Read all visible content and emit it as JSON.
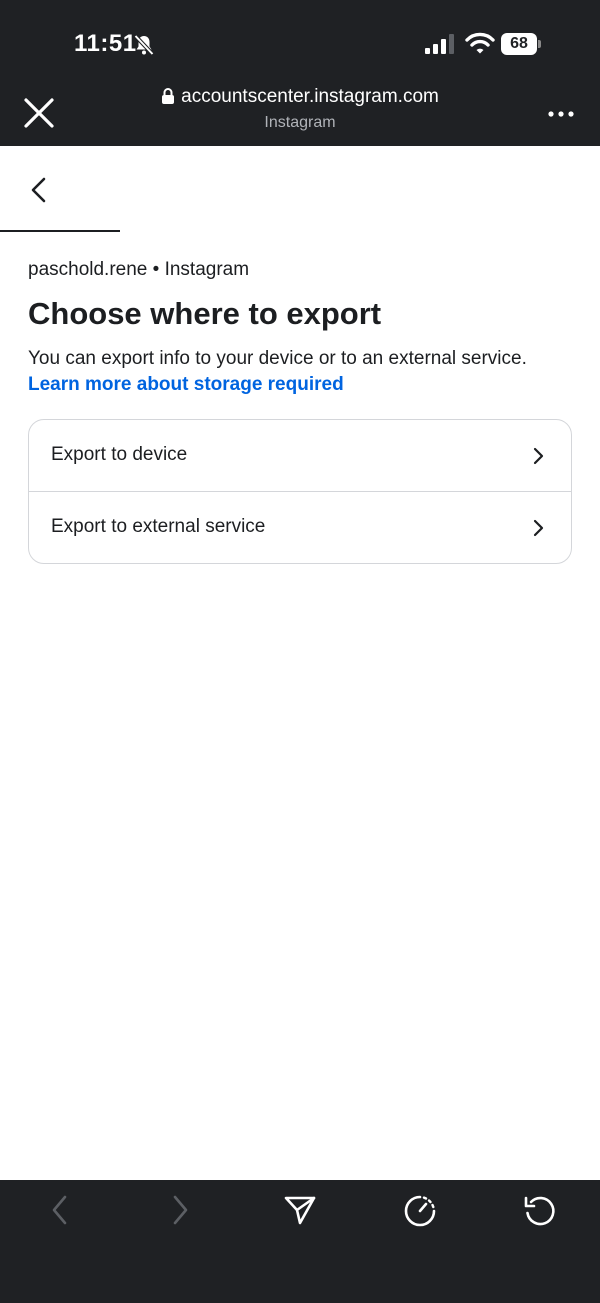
{
  "status_bar": {
    "time": "11:51",
    "battery": "68"
  },
  "browser": {
    "url": "accountscenter.instagram.com",
    "subtitle": "Instagram"
  },
  "content": {
    "account_line": "paschold.rene • Instagram",
    "title": "Choose where to export",
    "description": "You can export info to your device or to an external service.",
    "learn_more": "Learn more about storage required",
    "options": [
      {
        "label": "Export to device"
      },
      {
        "label": "Export to external service"
      }
    ]
  },
  "icons": {
    "top_left": "close-icon",
    "top_right": "more-icon",
    "back": "chevron-left-icon",
    "toolbar": [
      "back-arrow-icon",
      "forward-arrow-icon",
      "send-icon",
      "timer-icon",
      "reload-icon"
    ]
  },
  "colors": {
    "chrome": "#1f2124",
    "link": "#0064e0",
    "text": "#1c1e21",
    "border": "#d4d6da",
    "disabled": "#5c5f64"
  }
}
